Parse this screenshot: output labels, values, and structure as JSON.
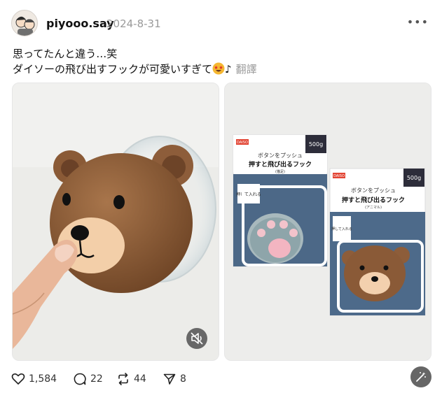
{
  "post": {
    "username": "piyooo.say",
    "date": "2024-8-31",
    "more_label": "•••",
    "line1": "思ってたんと違う…笑",
    "line2": "ダイソーの飛び出すフックが可愛いすぎて",
    "line2_suffix": "♪",
    "translate_label": "翻譯",
    "emoji_icon": "star-struck-emoji"
  },
  "media": {
    "left": {
      "type": "video",
      "subject": "bear-hook-photo",
      "mute_icon": "speaker-muted-icon"
    },
    "right": {
      "type": "image",
      "package_left": {
        "brand": "DAISO",
        "tagline": "ボタンをプッシュ",
        "title": "押すと飛び出るフック",
        "subtitle": "(猫足)",
        "weight_label": "耐荷重",
        "weight": "500g"
      },
      "package_right": {
        "brand": "DAISO",
        "tagline": "ボタンをプッシュ",
        "title": "押すと飛び出るフック",
        "subtitle": "(アニマル)",
        "weight_label": "耐荷重",
        "weight": "500g"
      },
      "side_label": "押して入れる"
    }
  },
  "actions": {
    "likes": "1,584",
    "comments": "22",
    "reposts": "44",
    "shares": "8"
  },
  "colors": {
    "bear_brown": "#8d5d3a",
    "bear_muzzle": "#f5d2b0",
    "package_blue": "#4a6585",
    "package_orange": "#e86a2b"
  }
}
